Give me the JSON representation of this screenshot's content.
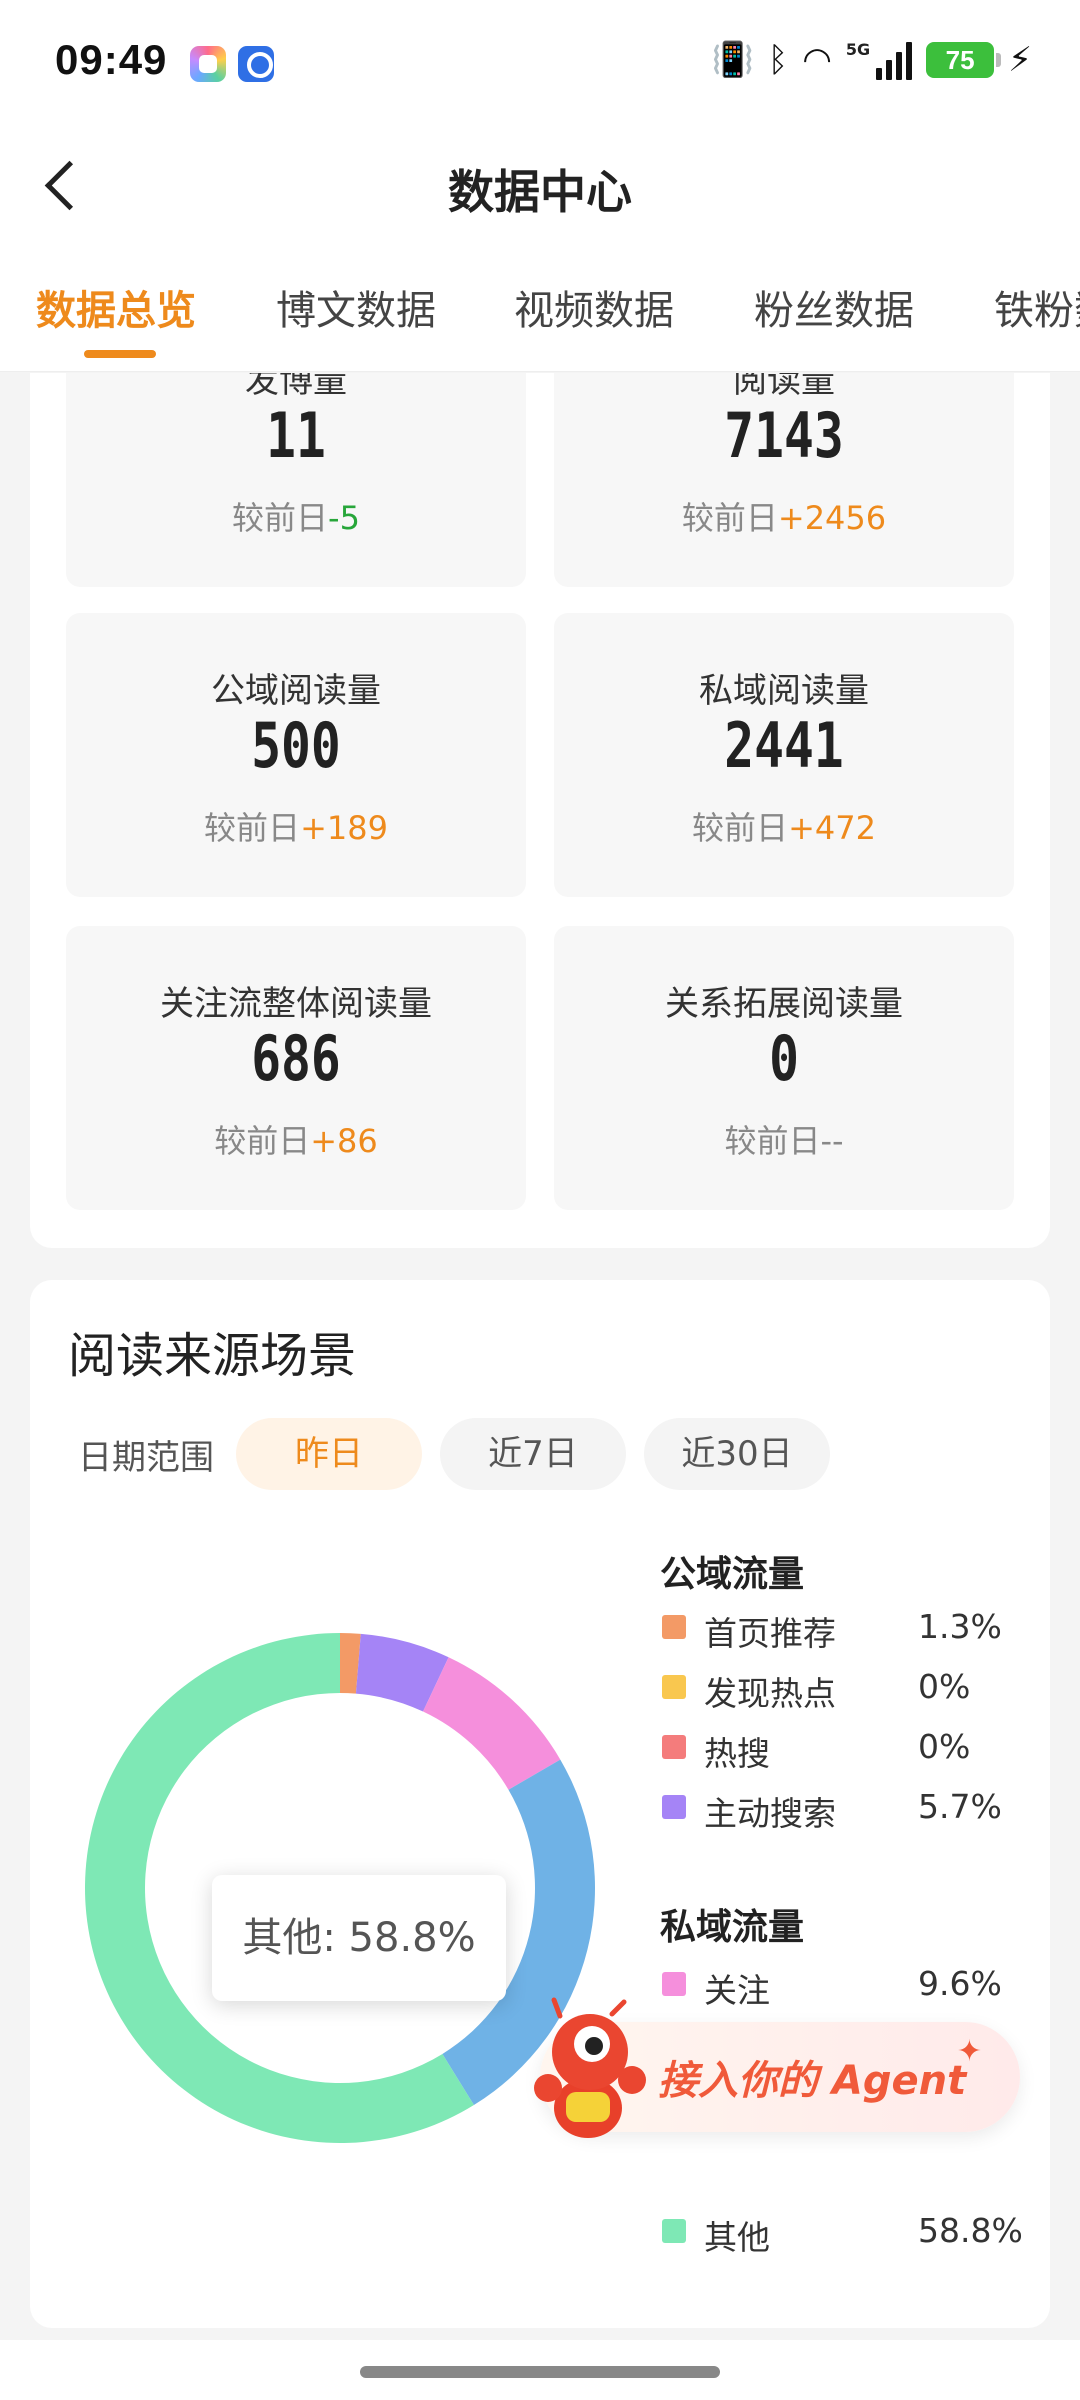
{
  "status_bar": {
    "time": "09:49",
    "battery": "75",
    "network": "5G"
  },
  "nav": {
    "title": "数据中心",
    "back_icon": "chevron-left-icon"
  },
  "tabs": [
    {
      "label": "数据总览",
      "active": true
    },
    {
      "label": "博文数据",
      "active": false
    },
    {
      "label": "视频数据",
      "active": false
    },
    {
      "label": "粉丝数据",
      "active": false
    },
    {
      "label": "铁粉数据",
      "active": false
    }
  ],
  "stats": [
    {
      "label": "发博量",
      "value": "11",
      "delta_prefix": "较前日",
      "delta": "-5",
      "trend": "down"
    },
    {
      "label": "阅读量",
      "value": "7143",
      "delta_prefix": "较前日",
      "delta": "+2456",
      "trend": "up"
    },
    {
      "label": "公域阅读量",
      "value": "500",
      "delta_prefix": "较前日",
      "delta": "+189",
      "trend": "up"
    },
    {
      "label": "私域阅读量",
      "value": "2441",
      "delta_prefix": "较前日",
      "delta": "+472",
      "trend": "up"
    },
    {
      "label": "关注流整体阅读量",
      "value": "686",
      "delta_prefix": "较前日",
      "delta": "+86",
      "trend": "up"
    },
    {
      "label": "关系拓展阅读量",
      "value": "0",
      "delta_prefix": "较前日",
      "delta": "--",
      "trend": "none"
    }
  ],
  "source_section": {
    "title": "阅读来源场景",
    "date_range_label": "日期范围",
    "ranges": [
      {
        "label": "昨日",
        "active": true
      },
      {
        "label": "近7日",
        "active": false
      },
      {
        "label": "近30日",
        "active": false
      }
    ],
    "tooltip": "其他: 58.8%",
    "public_group_title": "公域流量",
    "private_group_title": "私域流量"
  },
  "chart_data": {
    "type": "pie",
    "legend_position": "right",
    "labels": [
      "首页推荐",
      "发现热点",
      "热搜",
      "主动搜索",
      "关注",
      "其他"
    ],
    "values": [
      1.3,
      0,
      0,
      5.7,
      9.6,
      58.8
    ],
    "values_display": [
      "1.3%",
      "0%",
      "0%",
      "5.7%",
      "9.6%",
      "58.8%"
    ],
    "colors": [
      "#f39a66",
      "#f9c74f",
      "#f47c7c",
      "#a584f6",
      "#f58fdc",
      "#7ee8b5"
    ],
    "hidden_segment_color": "#6fb2e6",
    "hidden_segment_value": 24.6
  },
  "agent_banner": {
    "label": "接入你的 Agent",
    "spark": "✦"
  }
}
